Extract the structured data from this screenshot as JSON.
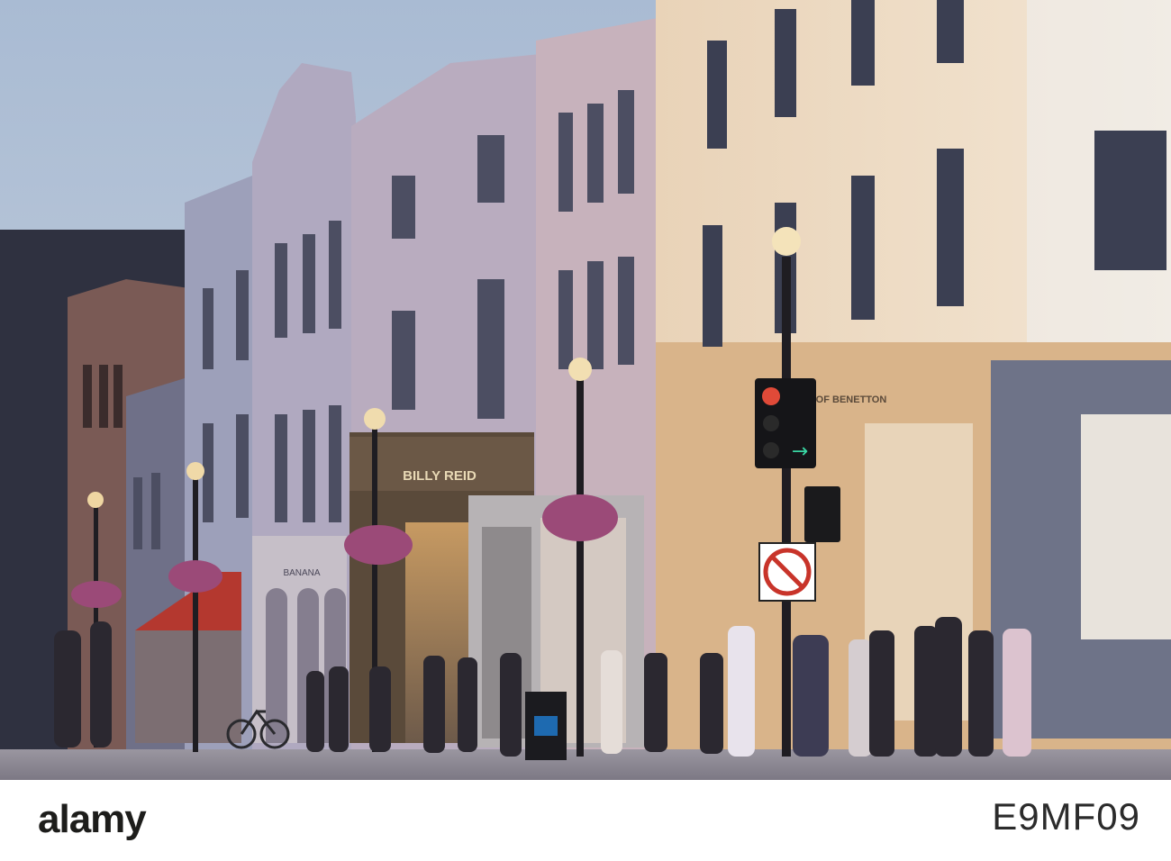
{
  "image": {
    "description_scene": "street-scene",
    "signs": {
      "storefront_sign": "BILLY REID",
      "storefront_sign_2": "OF BENETTON",
      "storefront_sign_3": "BANANA"
    }
  },
  "footer": {
    "brand": "alamy",
    "stock_id": "E9MF09"
  },
  "colors": {
    "sky": "#b9c8dc",
    "building_lit": "#d8bfa8",
    "building_shadow": "#6c6f86",
    "street": "#8d8a95",
    "footer_bg": "#ffffff",
    "brand_text": "#1d1d1b"
  }
}
